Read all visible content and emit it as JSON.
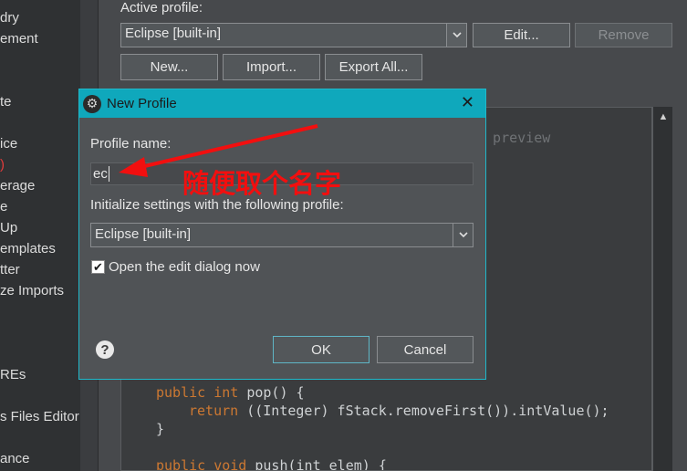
{
  "sidebar": {
    "items": [
      {
        "label": "dry",
        "red": false
      },
      {
        "label": "ement",
        "red": false
      },
      {
        "label": "te",
        "red": false
      },
      {
        "label": "ice",
        "red": false
      },
      {
        "label": ")",
        "red": true
      },
      {
        "label": "erage",
        "red": false
      },
      {
        "label": "e",
        "red": false
      },
      {
        "label": "Up",
        "red": false
      },
      {
        "label": "emplates",
        "red": false
      },
      {
        "label": "tter",
        "red": false
      },
      {
        "label": "ze Imports",
        "red": false
      },
      {
        "label": "REs",
        "red": false
      },
      {
        "label": "s Files Editor",
        "red": false
      },
      {
        "label": "ance",
        "red": false
      }
    ]
  },
  "main": {
    "active_profile_label": "Active profile:",
    "active_profile_value": "Eclipse [built-in]",
    "edit_button": "Edit...",
    "remove_button": "Remove",
    "new_button": "New...",
    "import_button": "Import...",
    "export_button": "Export All...",
    "preview_fragment": "r preview",
    "code_lines": [
      {
        "kw1": "public",
        "kw2": "int",
        "rest": " pop() {"
      },
      {
        "kw1": "return",
        "kw2": "",
        "rest": " ((Integer) fStack.removeFirst()).intValue();"
      },
      {
        "kw1": "",
        "kw2": "",
        "rest": "}"
      },
      {
        "kw1": "public",
        "kw2": "void",
        "rest": " push(int elem) {"
      }
    ]
  },
  "dialog": {
    "title": "New Profile",
    "profile_name_label": "Profile name:",
    "profile_name_value": "ec",
    "init_label": "Initialize settings with the following profile:",
    "init_value": "Eclipse [built-in]",
    "checkbox_label": "Open the edit dialog now",
    "checkbox_checked": true,
    "ok_button": "OK",
    "cancel_button": "Cancel"
  },
  "annotation": {
    "text": "随便取个名字",
    "color": "#f20f0f"
  },
  "colors": {
    "titlebar": "#0fa8bc",
    "keyword": "#cc7832"
  }
}
